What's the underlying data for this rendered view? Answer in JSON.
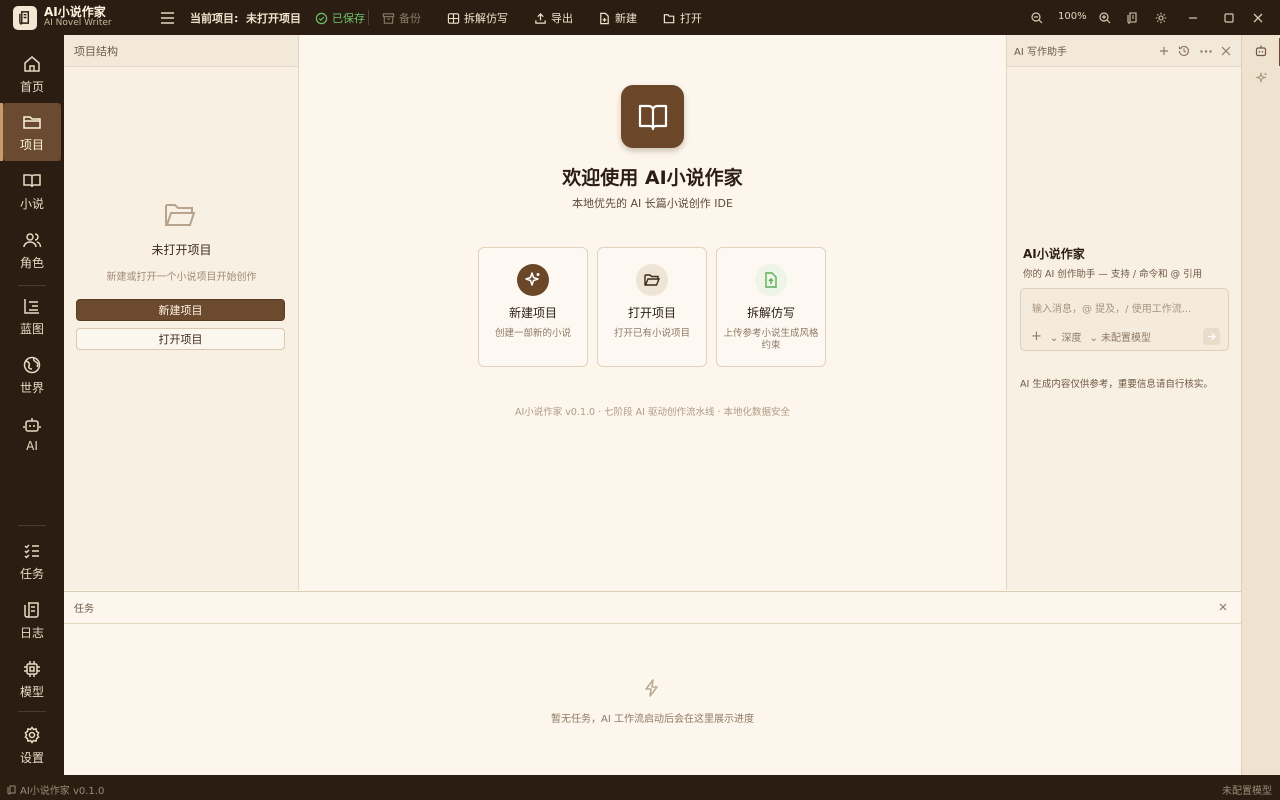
{
  "titlebar": {
    "app_name": "AI小说作家",
    "app_subtitle": "AI Novel Writer",
    "current_project_label": "当前项目:",
    "current_project_value": "未打开项目",
    "saved": "已保存",
    "backup": "备份",
    "deconstruct": "拆解仿写",
    "export": "导出",
    "new": "新建",
    "open": "打开",
    "zoom": "100%"
  },
  "nav": {
    "items": [
      {
        "label": "首页",
        "icon": "home-icon"
      },
      {
        "label": "项目",
        "icon": "folder-icon"
      },
      {
        "label": "小说",
        "icon": "book-icon"
      },
      {
        "label": "角色",
        "icon": "users-icon"
      },
      {
        "label": "蓝图",
        "icon": "blueprint-icon"
      },
      {
        "label": "世界",
        "icon": "globe-icon"
      },
      {
        "label": "AI",
        "icon": "bot-icon"
      }
    ],
    "bottom_items": [
      {
        "label": "任务",
        "icon": "tasks-icon"
      },
      {
        "label": "日志",
        "icon": "log-icon"
      },
      {
        "label": "模型",
        "icon": "chip-icon"
      },
      {
        "label": "设置",
        "icon": "gear-icon"
      }
    ],
    "active": "项目"
  },
  "project_panel": {
    "header": "项目结构",
    "empty_title": "未打开项目",
    "empty_sub": "新建或打开一个小说项目开始创作",
    "new_button": "新建项目",
    "open_button": "打开项目"
  },
  "welcome": {
    "title": "欢迎使用 AI小说作家",
    "subtitle": "本地优先的 AI 长篇小说创作 IDE",
    "cards": [
      {
        "title": "新建项目",
        "desc": "创建一部新的小说",
        "icon": "sparkle-icon"
      },
      {
        "title": "打开项目",
        "desc": "打开已有小说项目",
        "icon": "folder-open-icon"
      },
      {
        "title": "拆解仿写",
        "desc": "上传参考小说生成风格约束",
        "icon": "file-upload-icon"
      }
    ],
    "footer": "AI小说作家 v0.1.0 · 七阶段 AI 驱动创作流水线 · 本地化数据安全"
  },
  "ai_panel": {
    "header": "AI 写作助手",
    "title": "AI小说作家",
    "subtitle": "你的 AI 创作助手 — 支持 / 命令和 @ 引用",
    "placeholder": "输入消息，@ 提及，/ 使用工作流...",
    "depth": "深度",
    "model": "未配置模型",
    "note": "AI 生成内容仅供参考，重要信息请自行核实。"
  },
  "task_panel": {
    "header": "任务",
    "empty": "暂无任务，AI 工作流启动后会在这里展示进度"
  },
  "statusbar": {
    "left": "AI小说作家 v0.1.0",
    "right": "未配置模型"
  },
  "colors": {
    "dark_chrome": "#2b1d12",
    "accent_brown": "#6b4a2e",
    "saved_green": "#6cc46a",
    "background": "#faf3e8"
  }
}
